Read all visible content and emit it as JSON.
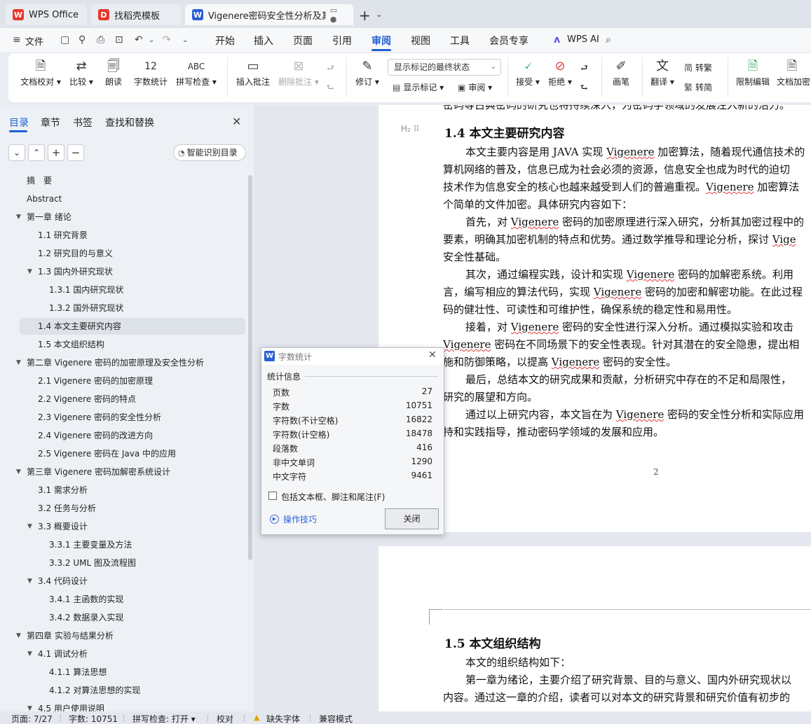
{
  "tabs": [
    {
      "label": "WPS Office"
    },
    {
      "label": "找稻壳模板"
    },
    {
      "label": "Vigenere密码安全性分析及其",
      "extra": "▭ ●"
    }
  ],
  "menubar": {
    "file": "文件",
    "items": [
      "开始",
      "插入",
      "页面",
      "引用",
      "审阅",
      "视图",
      "工具",
      "会员专享"
    ],
    "active": "审阅",
    "ai": "WPS AI"
  },
  "ribbon": {
    "buttons": [
      {
        "label": "文档校对 ▾",
        "icon": "document-check-icon"
      },
      {
        "label": "比较 ▾",
        "icon": "compare-icon"
      },
      {
        "label": "朗读",
        "icon": "read-aloud-icon"
      },
      {
        "label": "字数统计",
        "icon": "word-count-icon",
        "glyph": "12"
      },
      {
        "label": "拼写检查 ▾",
        "icon": "spell-check-icon",
        "glyph": "ABC"
      },
      {
        "label": "插入批注",
        "icon": "insert-comment-icon"
      },
      {
        "label": "删除批注 ▾",
        "icon": "delete-comment-icon",
        "disabled": true
      },
      {
        "label": "修订 ▾",
        "icon": "track-changes-icon"
      },
      {
        "label": "接受 ▾",
        "icon": "accept-icon"
      },
      {
        "label": "拒绝 ▾",
        "icon": "reject-icon"
      },
      {
        "label": "画笔",
        "icon": "pen-icon"
      },
      {
        "label": "翻译 ▾",
        "icon": "translate-icon"
      },
      {
        "label": "限制编辑",
        "icon": "restrict-edit-icon"
      },
      {
        "label": "文档加密",
        "icon": "encrypt-icon"
      }
    ],
    "markup_select": "显示标记的最终状态",
    "show_markup": "显示标记 ▾",
    "review": "审阅 ▾",
    "to_traditional": "转繁",
    "to_simplified": "转简"
  },
  "nav": {
    "tabs": [
      "目录",
      "章节",
      "书签",
      "查找和替换"
    ],
    "smart_btn": "智能识别目录",
    "toc": [
      {
        "label": "摘　要",
        "level": 0
      },
      {
        "label": "Abstract",
        "level": 0
      },
      {
        "label": "第一章  绪论",
        "level": 0,
        "caret": true
      },
      {
        "label": "1.1  研究背景",
        "level": 1
      },
      {
        "label": "1.2  研究目的与意义",
        "level": 1
      },
      {
        "label": "1.3  国内外研究现状",
        "level": 1,
        "caret": true
      },
      {
        "label": "1.3.1 国内研究现状",
        "level": 2
      },
      {
        "label": "1.3.2 国外研究现状",
        "level": 2
      },
      {
        "label": "1.4  本文主要研究内容",
        "level": 1,
        "selected": true
      },
      {
        "label": "1.5  本文组织结构",
        "level": 1
      },
      {
        "label": "第二章  Vigenere 密码的加密原理及安全性分析",
        "level": 0,
        "caret": true
      },
      {
        "label": "2.1 Vigenere 密码的加密原理",
        "level": 1
      },
      {
        "label": "2.2 Vigenere 密码的特点",
        "level": 1
      },
      {
        "label": "2.3 Vigenere 密码的安全性分析",
        "level": 1
      },
      {
        "label": "2.4 Vigenere 密码的改进方向",
        "level": 1
      },
      {
        "label": "2.5 Vigenere 密码在 Java 中的应用",
        "level": 1
      },
      {
        "label": "第三章  Vigenere 密码加解密系统设计",
        "level": 0,
        "caret": true
      },
      {
        "label": "3.1 需求分析",
        "level": 1
      },
      {
        "label": "3.2 任务与分析",
        "level": 1
      },
      {
        "label": "3.3 概要设计",
        "level": 1,
        "caret": true
      },
      {
        "label": "3.3.1 主要变量及方法",
        "level": 2
      },
      {
        "label": "3.3.2 UML 图及流程图",
        "level": 2
      },
      {
        "label": "3.4  代码设计",
        "level": 1,
        "caret": true
      },
      {
        "label": "3.4.1 主函数的实现",
        "level": 2
      },
      {
        "label": "3.4.2 数据录入实现",
        "level": 2
      },
      {
        "label": "第四章  实验与结果分析",
        "level": 0,
        "caret": true
      },
      {
        "label": "4.1  调试分析",
        "level": 1,
        "caret": true
      },
      {
        "label": "4.1.1  算法思想",
        "level": 2
      },
      {
        "label": "4.1.2 对算法思想的实现",
        "level": 2
      },
      {
        "label": "4.5 用户使用说明",
        "level": 1,
        "caret": true
      }
    ]
  },
  "doc": {
    "top_line": "密码等古典密码的研究也将持续深入，为密码学领域的发展注入新的活力。",
    "heading_14": "1.4  本文主要研究内容",
    "para1": [
      "本文主要内容是用 JAVA 实现 ",
      "Vigenere",
      " 加密算法，随着现代通信技术的"
    ],
    "para1b": "算机网络的普及，信息已成为社会必须的资源，信息安全也成为时代的迫切",
    "para1c": [
      "技术作为信息安全的核心也越来越受到人们的普遍重视。",
      "Vigenere",
      " 加密算法"
    ],
    "para1d": "个简单的文件加密。具体研究内容如下：",
    "para2": [
      "首先，对 ",
      "Vigenere",
      " 密码的加密原理进行深入研究，分析其加密过程中的"
    ],
    "para2b": [
      "要素，明确其加密机制的特点和优势。通过数学推导和理论分析，探讨 ",
      "Vige"
    ],
    "para2c": "安全性基础。",
    "para3": [
      "其次，通过编程实践，设计和实现 ",
      "Vigenere",
      " 密码的加解密系统。利用"
    ],
    "para3b": [
      "言，编写相应的算法代码，实现 ",
      "Vigenere",
      " 密码的加密和解密功能。在此过程"
    ],
    "para3c": "码的健壮性、可读性和可维护性，确保系统的稳定性和易用性。",
    "para4": [
      "接着，对 ",
      "Vigenere",
      " 密码的安全性进行深入分析。通过模拟实验和攻击"
    ],
    "para4b": [
      "Vigenere",
      " 密码在不同场景下的安全性表现。针对其潜在的安全隐患，提出相"
    ],
    "para4c": [
      "施和防御策略，以提高 ",
      "Vigenere",
      " 密码的安全性。"
    ],
    "para5": "最后，总结本文的研究成果和贡献，分析研究中存在的不足和局限性，",
    "para5b": "研究的展望和方向。",
    "para6": [
      "通过以上研究内容，本文旨在为 ",
      "Vigenere",
      " 密码的安全性分析和实际应用"
    ],
    "para6b": "持和实践指导，推动密码学领域的发展和应用。",
    "page_number": "2",
    "heading_15": "1.5  本文组织结构",
    "p15a": "本文的组织结构如下：",
    "p15b": "第一章为绪论，主要介绍了研究背景、目的与意义、国内外研究现状以",
    "p15c": "内容。通过这一章的介绍，读者可以对本文的研究背景和研究价值有初步的"
  },
  "dialog": {
    "title": "字数统计",
    "section": "统计信息",
    "rows": [
      {
        "label": "页数",
        "value": "27"
      },
      {
        "label": "字数",
        "value": "10751"
      },
      {
        "label": "字符数(不计空格)",
        "value": "16822"
      },
      {
        "label": "字符数(计空格)",
        "value": "18478"
      },
      {
        "label": "段落数",
        "value": "416"
      },
      {
        "label": "非中文单词",
        "value": "1290"
      },
      {
        "label": "中文字符",
        "value": "9461"
      }
    ],
    "checkbox": "包括文本框、脚注和尾注(F)",
    "tips": "操作技巧",
    "close": "关闭"
  },
  "status": {
    "page": "页面: 7/27",
    "words": "字数: 10751",
    "spell": "拼写检查: 打开 ▾",
    "proof": "校对",
    "missing_font": "缺失字体",
    "compat": "兼容模式"
  }
}
